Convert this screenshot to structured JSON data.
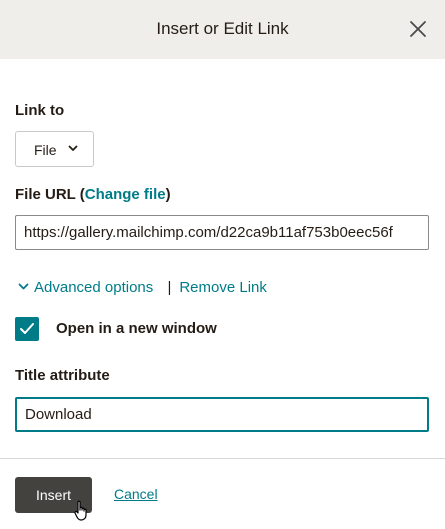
{
  "dialog": {
    "title": "Insert or Edit Link",
    "close_icon": "close-icon"
  },
  "link_to": {
    "label": "Link to",
    "selected": "File",
    "icon": "chevron-down-icon"
  },
  "file_url": {
    "label_prefix": "File URL (",
    "change_link": "Change file",
    "label_suffix": ")",
    "value": "https://gallery.mailchimp.com/d22ca9b11af753b0eec56f"
  },
  "advanced": {
    "toggle_label": "Advanced options",
    "separator": "|",
    "remove_link": "Remove Link",
    "icon": "chevron-down-icon"
  },
  "new_window": {
    "checked": true,
    "label": "Open in a new window"
  },
  "title_attribute": {
    "label": "Title attribute",
    "value": "Download"
  },
  "footer": {
    "insert_label": "Insert",
    "cancel_label": "Cancel"
  },
  "colors": {
    "accent": "#007c89",
    "header_bg": "#efeeea",
    "primary_button": "#43423f"
  }
}
